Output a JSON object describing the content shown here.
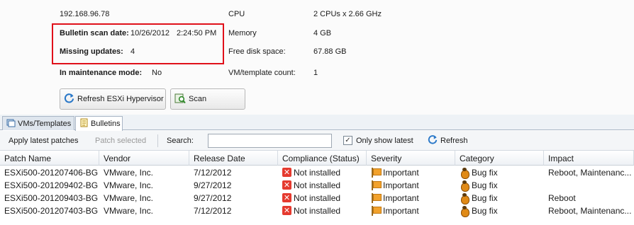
{
  "host": {
    "ip": "192.168.96.78",
    "scan_date_label": "Bulletin scan date:",
    "scan_date_value": "10/26/2012",
    "scan_time_value": "2:24:50 PM",
    "missing_label": "Missing updates:",
    "missing_value": "4",
    "maintenance_label": "In maintenance mode:",
    "maintenance_value": "No"
  },
  "specs": {
    "cpu_label": "CPU",
    "cpu_value": "2 CPUs x 2.66 GHz",
    "memory_label": "Memory",
    "memory_value": "4 GB",
    "disk_label": "Free disk space:",
    "disk_value": "67.88 GB",
    "vm_label": "VM/template count:",
    "vm_value": "1"
  },
  "buttons": {
    "refresh": "Refresh ESXi Hypervisor",
    "scan": "Scan"
  },
  "tabs": [
    {
      "label": "VMs/Templates",
      "active": false
    },
    {
      "label": "Bulletins",
      "active": true
    }
  ],
  "toolbar": {
    "apply": "Apply latest patches",
    "patch_selected": "Patch selected",
    "search_label": "Search:",
    "search_value": "",
    "only_latest": "Only show latest",
    "only_latest_checked": true,
    "refresh": "Refresh"
  },
  "table": {
    "columns": [
      "Patch Name",
      "Vendor",
      "Release Date",
      "Compliance (Status)",
      "Severity",
      "Category",
      "Impact"
    ],
    "rows": [
      [
        "ESXi500-201207406-BG",
        "VMware, Inc.",
        "7/12/2012",
        "Not installed",
        "Important",
        "Bug fix",
        "Reboot, Maintenanc..."
      ],
      [
        "ESXi500-201209402-BG",
        "VMware, Inc.",
        "9/27/2012",
        "Not installed",
        "Important",
        "Bug fix",
        ""
      ],
      [
        "ESXi500-201209403-BG",
        "VMware, Inc.",
        "9/27/2012",
        "Not installed",
        "Important",
        "Bug fix",
        "Reboot"
      ],
      [
        "ESXi500-201207403-BG",
        "VMware, Inc.",
        "7/12/2012",
        "Not installed",
        "Important",
        "Bug fix",
        "Reboot, Maintenanc..."
      ]
    ]
  },
  "colors": {
    "highlight_border": "#e0101a",
    "not_installed": "#e53a2f",
    "severity_flag": "#f2a22c",
    "bug_icon": "#e08a17"
  },
  "icons": {
    "refresh": "refresh-icon",
    "scan": "scan-icon",
    "not_installed": "x-icon",
    "severity": "flag-icon",
    "category": "bug-icon"
  }
}
